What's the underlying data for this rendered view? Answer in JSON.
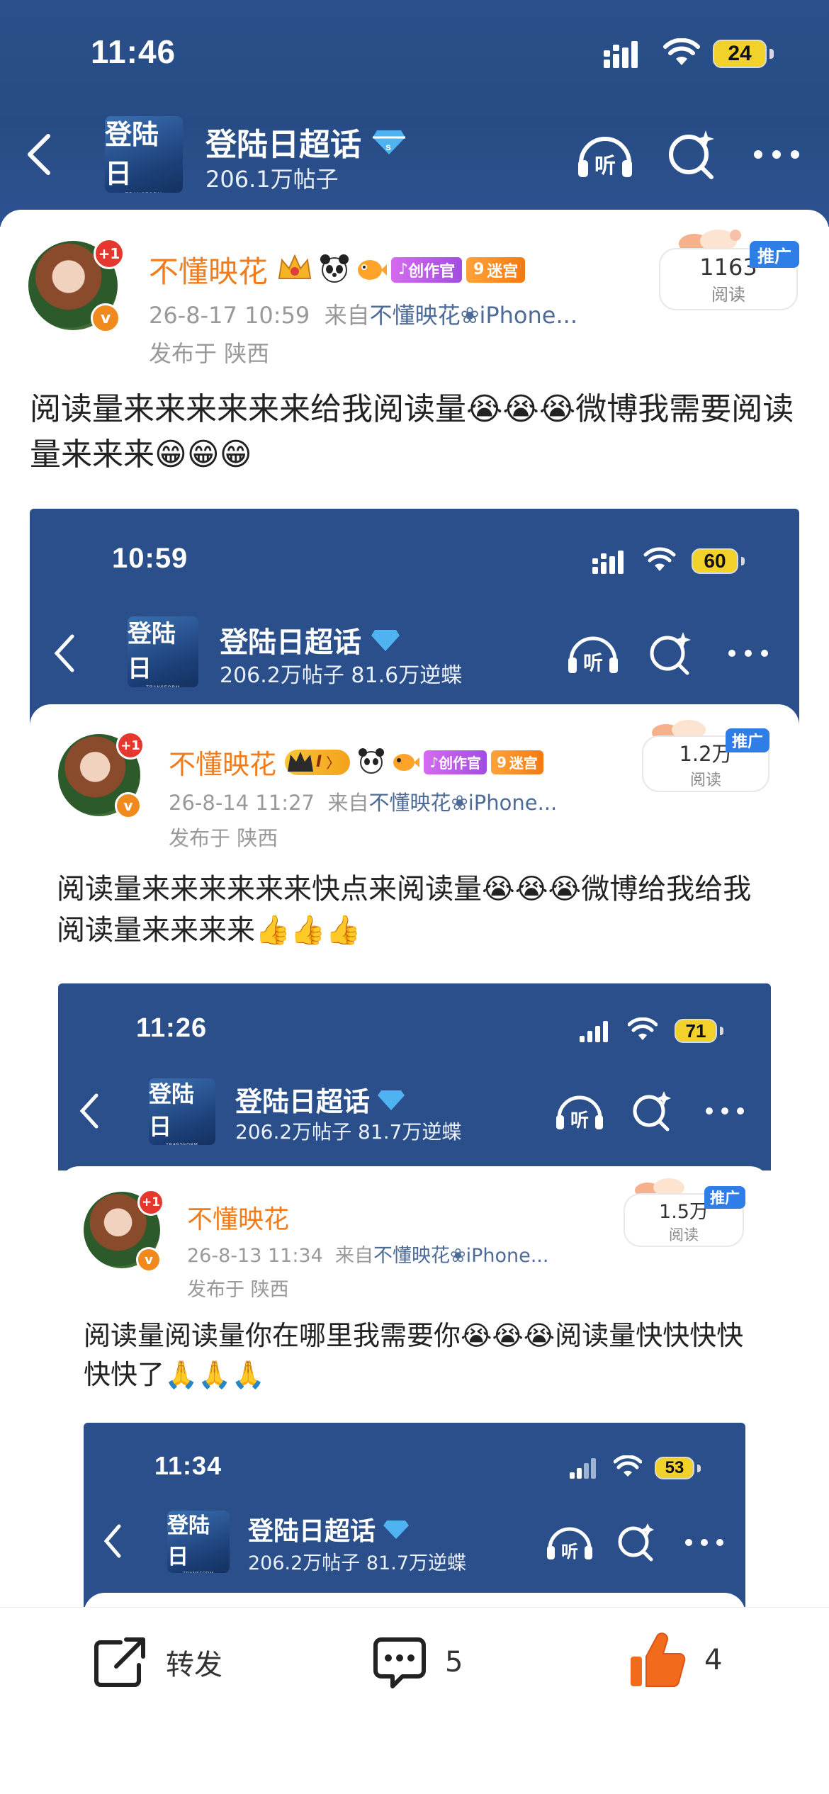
{
  "status": {
    "time": "11:46",
    "battery": "24"
  },
  "header": {
    "logo_text": "登陆日",
    "title": "登陆日超话",
    "subtitle": "206.1万帖子"
  },
  "post": {
    "username": "不懂映花",
    "plus": "+1",
    "tags": {
      "creator": "创作官",
      "maze": "迷宫",
      "maze_num": "9"
    },
    "time": "26-8-17 10:59",
    "from_prefix": "来自",
    "from_link": "不懂映花❀iPhone...",
    "location": "发布于 陕西",
    "text": "阅读量来来来来来来给我阅读量😭😭😭微博我需要阅读量来来来😁😁😁",
    "reads_num": "1163",
    "reads_label": "阅读",
    "promo": "推广"
  },
  "shot1": {
    "time": "10:59",
    "battery": "60",
    "title": "登陆日超话",
    "subtitle": "206.2万帖子 81.6万逆蝶",
    "username": "不懂映花",
    "level": "I",
    "date": "26-8-14 11:27",
    "from_prefix": "来自",
    "from_link": "不懂映花❀iPhone...",
    "location": "发布于 陕西",
    "text": "阅读量来来来来来来快点来阅读量😭😭😭微博给我给我阅读量来来来来👍👍👍",
    "reads_num": "1.2万",
    "reads_label": "阅读",
    "promo": "推广"
  },
  "shot2": {
    "time": "11:26",
    "battery": "71",
    "title": "登陆日超话",
    "subtitle": "206.2万帖子 81.7万逆蝶",
    "username": "不懂映花",
    "date": "26-8-13 11:34",
    "from_prefix": "来自",
    "from_link": "不懂映花❀iPhone...",
    "location": "发布于 陕西",
    "text": "阅读量阅读量你在哪里我需要你😭😭😭阅读量快快快快快快了🙏🙏🙏",
    "reads_num": "1.5万",
    "reads_label": "阅读",
    "promo": "推广"
  },
  "shot3": {
    "time": "11:34",
    "battery": "53",
    "title": "登陆日超话",
    "subtitle": "206.2万帖子 81.7万逆蝶"
  },
  "bottom": {
    "repost": "转发",
    "comments": "5",
    "likes": "4"
  },
  "colors": {
    "header_blue": "#2a4f8a",
    "username_orange": "#f07c1c",
    "link_blue": "#4d6b98",
    "like_orange": "#f26b1d"
  }
}
